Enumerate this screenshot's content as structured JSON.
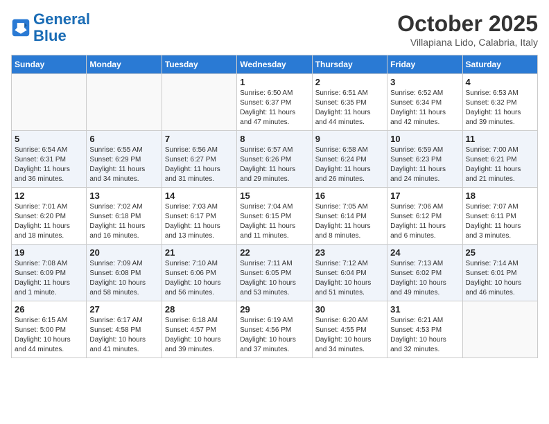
{
  "logo": {
    "line1": "General",
    "line2": "Blue"
  },
  "title": "October 2025",
  "location": "Villapiana Lido, Calabria, Italy",
  "days_of_week": [
    "Sunday",
    "Monday",
    "Tuesday",
    "Wednesday",
    "Thursday",
    "Friday",
    "Saturday"
  ],
  "weeks": [
    [
      {
        "day": "",
        "info": ""
      },
      {
        "day": "",
        "info": ""
      },
      {
        "day": "",
        "info": ""
      },
      {
        "day": "1",
        "info": "Sunrise: 6:50 AM\nSunset: 6:37 PM\nDaylight: 11 hours\nand 47 minutes."
      },
      {
        "day": "2",
        "info": "Sunrise: 6:51 AM\nSunset: 6:35 PM\nDaylight: 11 hours\nand 44 minutes."
      },
      {
        "day": "3",
        "info": "Sunrise: 6:52 AM\nSunset: 6:34 PM\nDaylight: 11 hours\nand 42 minutes."
      },
      {
        "day": "4",
        "info": "Sunrise: 6:53 AM\nSunset: 6:32 PM\nDaylight: 11 hours\nand 39 minutes."
      }
    ],
    [
      {
        "day": "5",
        "info": "Sunrise: 6:54 AM\nSunset: 6:31 PM\nDaylight: 11 hours\nand 36 minutes."
      },
      {
        "day": "6",
        "info": "Sunrise: 6:55 AM\nSunset: 6:29 PM\nDaylight: 11 hours\nand 34 minutes."
      },
      {
        "day": "7",
        "info": "Sunrise: 6:56 AM\nSunset: 6:27 PM\nDaylight: 11 hours\nand 31 minutes."
      },
      {
        "day": "8",
        "info": "Sunrise: 6:57 AM\nSunset: 6:26 PM\nDaylight: 11 hours\nand 29 minutes."
      },
      {
        "day": "9",
        "info": "Sunrise: 6:58 AM\nSunset: 6:24 PM\nDaylight: 11 hours\nand 26 minutes."
      },
      {
        "day": "10",
        "info": "Sunrise: 6:59 AM\nSunset: 6:23 PM\nDaylight: 11 hours\nand 24 minutes."
      },
      {
        "day": "11",
        "info": "Sunrise: 7:00 AM\nSunset: 6:21 PM\nDaylight: 11 hours\nand 21 minutes."
      }
    ],
    [
      {
        "day": "12",
        "info": "Sunrise: 7:01 AM\nSunset: 6:20 PM\nDaylight: 11 hours\nand 18 minutes."
      },
      {
        "day": "13",
        "info": "Sunrise: 7:02 AM\nSunset: 6:18 PM\nDaylight: 11 hours\nand 16 minutes."
      },
      {
        "day": "14",
        "info": "Sunrise: 7:03 AM\nSunset: 6:17 PM\nDaylight: 11 hours\nand 13 minutes."
      },
      {
        "day": "15",
        "info": "Sunrise: 7:04 AM\nSunset: 6:15 PM\nDaylight: 11 hours\nand 11 minutes."
      },
      {
        "day": "16",
        "info": "Sunrise: 7:05 AM\nSunset: 6:14 PM\nDaylight: 11 hours\nand 8 minutes."
      },
      {
        "day": "17",
        "info": "Sunrise: 7:06 AM\nSunset: 6:12 PM\nDaylight: 11 hours\nand 6 minutes."
      },
      {
        "day": "18",
        "info": "Sunrise: 7:07 AM\nSunset: 6:11 PM\nDaylight: 11 hours\nand 3 minutes."
      }
    ],
    [
      {
        "day": "19",
        "info": "Sunrise: 7:08 AM\nSunset: 6:09 PM\nDaylight: 11 hours\nand 1 minute."
      },
      {
        "day": "20",
        "info": "Sunrise: 7:09 AM\nSunset: 6:08 PM\nDaylight: 10 hours\nand 58 minutes."
      },
      {
        "day": "21",
        "info": "Sunrise: 7:10 AM\nSunset: 6:06 PM\nDaylight: 10 hours\nand 56 minutes."
      },
      {
        "day": "22",
        "info": "Sunrise: 7:11 AM\nSunset: 6:05 PM\nDaylight: 10 hours\nand 53 minutes."
      },
      {
        "day": "23",
        "info": "Sunrise: 7:12 AM\nSunset: 6:04 PM\nDaylight: 10 hours\nand 51 minutes."
      },
      {
        "day": "24",
        "info": "Sunrise: 7:13 AM\nSunset: 6:02 PM\nDaylight: 10 hours\nand 49 minutes."
      },
      {
        "day": "25",
        "info": "Sunrise: 7:14 AM\nSunset: 6:01 PM\nDaylight: 10 hours\nand 46 minutes."
      }
    ],
    [
      {
        "day": "26",
        "info": "Sunrise: 6:15 AM\nSunset: 5:00 PM\nDaylight: 10 hours\nand 44 minutes."
      },
      {
        "day": "27",
        "info": "Sunrise: 6:17 AM\nSunset: 4:58 PM\nDaylight: 10 hours\nand 41 minutes."
      },
      {
        "day": "28",
        "info": "Sunrise: 6:18 AM\nSunset: 4:57 PM\nDaylight: 10 hours\nand 39 minutes."
      },
      {
        "day": "29",
        "info": "Sunrise: 6:19 AM\nSunset: 4:56 PM\nDaylight: 10 hours\nand 37 minutes."
      },
      {
        "day": "30",
        "info": "Sunrise: 6:20 AM\nSunset: 4:55 PM\nDaylight: 10 hours\nand 34 minutes."
      },
      {
        "day": "31",
        "info": "Sunrise: 6:21 AM\nSunset: 4:53 PM\nDaylight: 10 hours\nand 32 minutes."
      },
      {
        "day": "",
        "info": ""
      }
    ]
  ]
}
